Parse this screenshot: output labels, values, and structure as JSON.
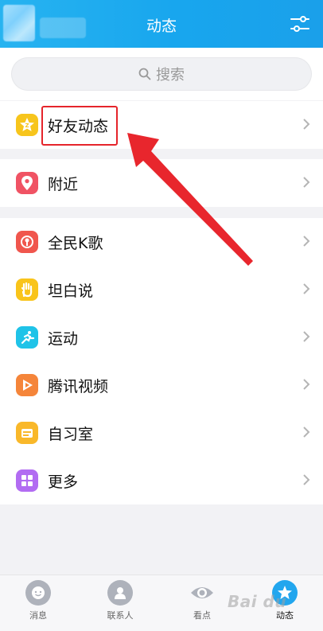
{
  "header": {
    "title": "动态"
  },
  "search": {
    "placeholder": "搜索"
  },
  "groups": {
    "friends": {
      "label": "好友动态"
    },
    "nearby": {
      "label": "附近"
    },
    "apps": [
      {
        "label": "全民K歌"
      },
      {
        "label": "坦白说"
      },
      {
        "label": "运动"
      },
      {
        "label": "腾讯视频"
      },
      {
        "label": "自习室"
      },
      {
        "label": "更多"
      }
    ]
  },
  "tabs": [
    {
      "label": "消息"
    },
    {
      "label": "联系人"
    },
    {
      "label": "看点"
    },
    {
      "label": "动态"
    }
  ],
  "watermark": "Bai du",
  "colors": {
    "header": "#1aa7ee",
    "highlight": "#e5242b"
  }
}
